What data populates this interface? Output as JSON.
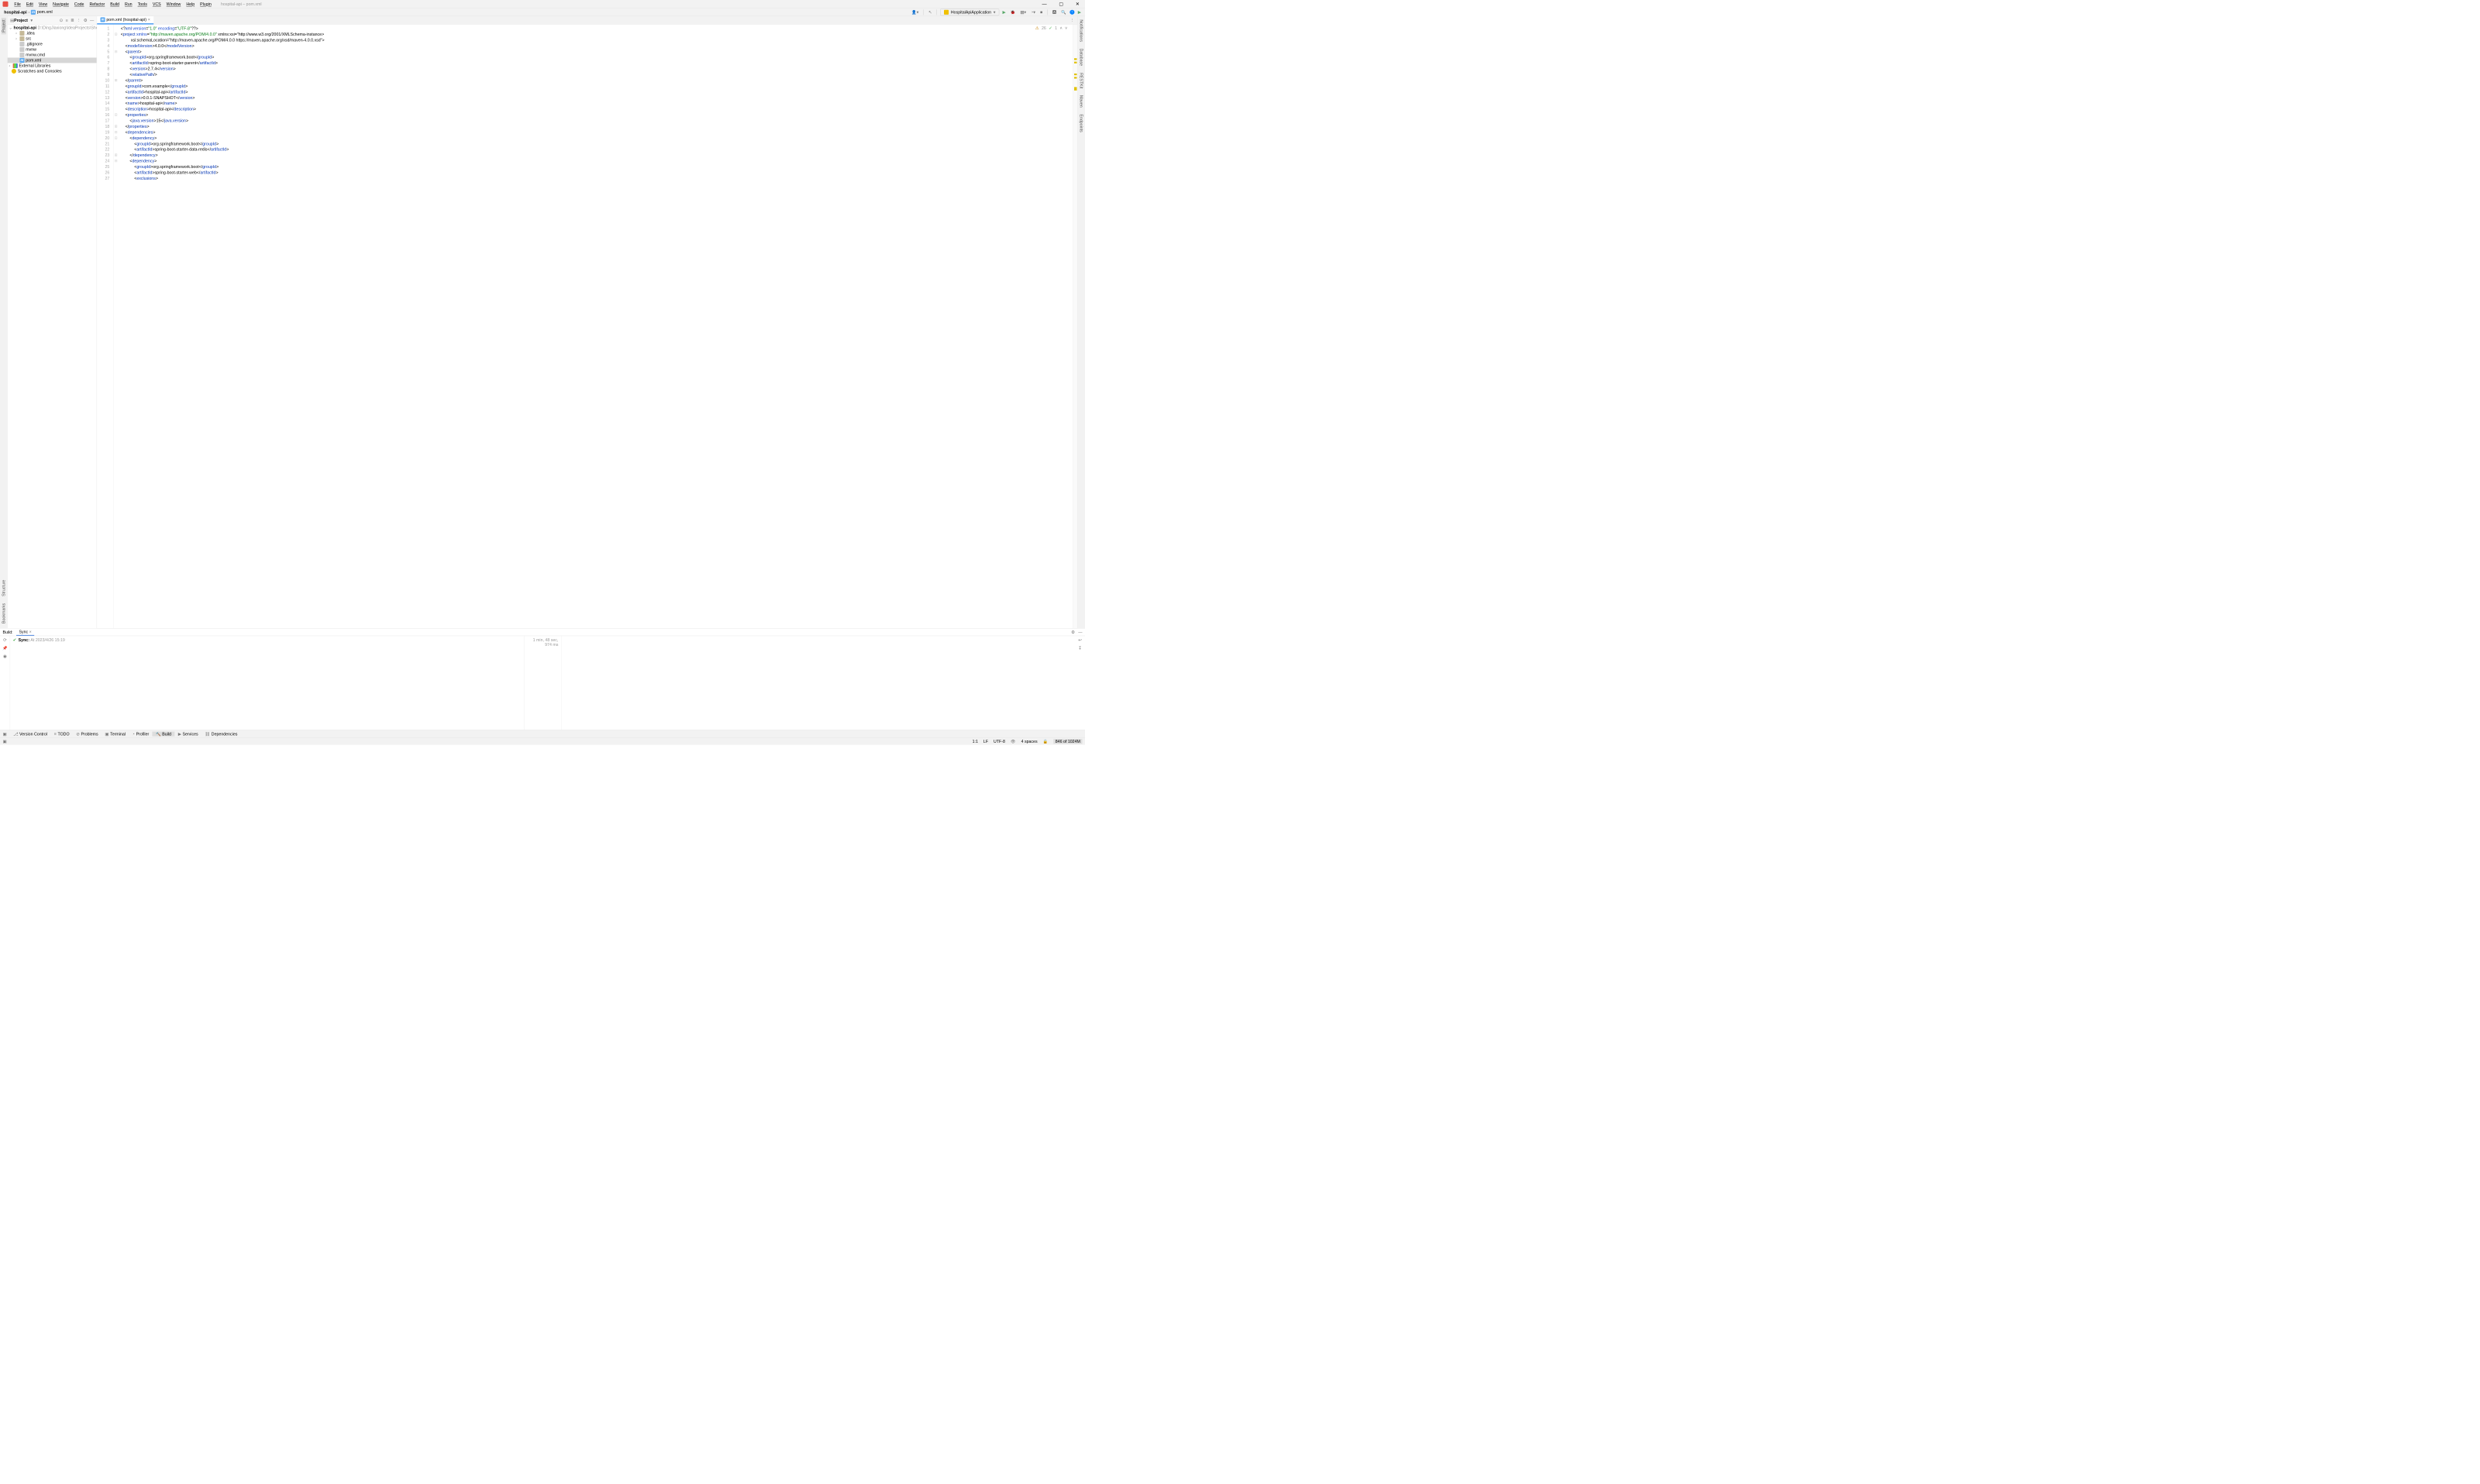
{
  "titlebar": {
    "menus": [
      "File",
      "Edit",
      "View",
      "Navigate",
      "Code",
      "Refactor",
      "Build",
      "Run",
      "Tools",
      "VCS",
      "Window",
      "Help",
      "Plugin"
    ],
    "title": "hospital-api – pom.xml"
  },
  "breadcrumb": {
    "project": "hospital-api",
    "file": "pom.xml"
  },
  "toolbar": {
    "run_config": "HospitalApiApplication"
  },
  "project_panel": {
    "title": "Project",
    "root_name": "hospital-api",
    "root_path": "D:\\DingJiaxiong\\IdeaProjects\\Shenzhou",
    "items": [
      {
        "label": ".idea",
        "indent": 1,
        "arrow": "›",
        "icon": "folder"
      },
      {
        "label": "src",
        "indent": 1,
        "arrow": "›",
        "icon": "folder"
      },
      {
        "label": ".gitignore",
        "indent": 1,
        "arrow": "",
        "icon": "file"
      },
      {
        "label": "mvnw",
        "indent": 1,
        "arrow": "",
        "icon": "file"
      },
      {
        "label": "mvnw.cmd",
        "indent": 1,
        "arrow": "",
        "icon": "file"
      },
      {
        "label": "pom.xml",
        "indent": 1,
        "arrow": "",
        "icon": "m",
        "selected": true
      }
    ],
    "ext_lib": "External Libraries",
    "scratches": "Scratches and Consoles"
  },
  "editor": {
    "tab_label": "pom.xml (hospital-api)",
    "warnings": "26",
    "typos": "1",
    "lines": [
      {
        "n": 1,
        "raw": "<?xml version=\"1.0\" encoding=\"UTF-8\"?>"
      },
      {
        "n": 2,
        "raw": "<project xmlns=\"http://maven.apache.org/POM/4.0.0\" xmlns:xsi=\"http://www.w3.org/2001/XMLSchema-instance\""
      },
      {
        "n": 3,
        "raw": "         xsi:schemaLocation=\"http://maven.apache.org/POM/4.0.0 https://maven.apache.org/xsd/maven-4.0.0.xsd\">"
      },
      {
        "n": 4,
        "raw": "    <modelVersion>4.0.0</modelVersion>"
      },
      {
        "n": 5,
        "raw": "    <parent>"
      },
      {
        "n": 6,
        "raw": "        <groupId>org.springframework.boot</groupId>"
      },
      {
        "n": 7,
        "raw": "        <artifactId>spring-boot-starter-parent</artifactId>"
      },
      {
        "n": 8,
        "raw": "        <version>2.7.4</version>"
      },
      {
        "n": 9,
        "raw": "        <relativePath/>"
      },
      {
        "n": 10,
        "raw": "    </parent>"
      },
      {
        "n": 11,
        "raw": "    <groupId>com.example</groupId>"
      },
      {
        "n": 12,
        "raw": "    <artifactId>hospital-api</artifactId>"
      },
      {
        "n": 13,
        "raw": "    <version>0.0.1-SNAPSHOT</version>"
      },
      {
        "n": 14,
        "raw": "    <name>hospital-api</name>"
      },
      {
        "n": 15,
        "raw": "    <description>hospital-api</description>"
      },
      {
        "n": 16,
        "raw": "    <properties>"
      },
      {
        "n": 17,
        "raw": "        <java.version>15</java.version>"
      },
      {
        "n": 18,
        "raw": "    </properties>"
      },
      {
        "n": 19,
        "raw": "    <dependencies>"
      },
      {
        "n": 20,
        "raw": "        <dependency>"
      },
      {
        "n": 21,
        "raw": "            <groupId>org.springframework.boot</groupId>"
      },
      {
        "n": 22,
        "raw": "            <artifactId>spring-boot-starter-data-redis</artifactId>"
      },
      {
        "n": 23,
        "raw": "        </dependency>"
      },
      {
        "n": 24,
        "raw": "        <dependency>"
      },
      {
        "n": 25,
        "raw": "            <groupId>org.springframework.boot</groupId>"
      },
      {
        "n": 26,
        "raw": "            <artifactId>spring-boot-starter-web</artifactId>"
      },
      {
        "n": 27,
        "raw": "            <exclusions>"
      }
    ]
  },
  "left_rail": {
    "project": "Project",
    "structure": "Structure",
    "bookmarks": "Bookmarks"
  },
  "right_rail": {
    "notifications": "Notifications",
    "database": "Database",
    "restkit": "RESTKit",
    "maven": "Maven",
    "endpoints": "Endpoints"
  },
  "build": {
    "title": "Build:",
    "tab": "Sync",
    "sync_label": "Sync:",
    "sync_at": "At 2023/4/26 15:19",
    "elapsed": "1 min, 48 sec, 974 ms"
  },
  "bottom_tools": {
    "version_control": "Version Control",
    "todo": "TODO",
    "problems": "Problems",
    "terminal": "Terminal",
    "profiler": "Profiler",
    "build": "Build",
    "services": "Services",
    "dependencies": "Dependencies"
  },
  "statusbar": {
    "pos": "1:1",
    "eol": "LF",
    "enc": "UTF-8",
    "indent": "4 spaces",
    "mem": "846 of 1024M"
  }
}
